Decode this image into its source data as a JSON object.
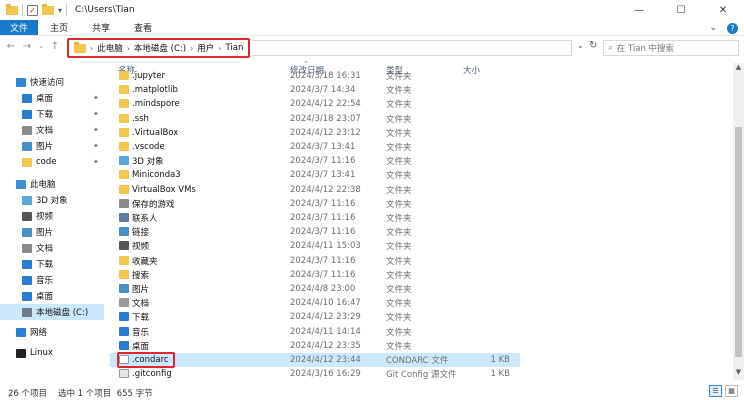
{
  "window": {
    "title": "C:\\Users\\Tian",
    "controls": [
      "—",
      "☐",
      "✕"
    ]
  },
  "ribbon": {
    "tabs": [
      "文件",
      "主页",
      "共享",
      "查看"
    ],
    "expand_icon": "chevron-down-icon",
    "help_label": "?"
  },
  "address": {
    "breadcrumbs": [
      "此电脑",
      "本地磁盘 (C:)",
      "用户",
      "Tian"
    ],
    "search_placeholder": "在 Tian 中搜索"
  },
  "columns": {
    "name": "名称",
    "date": "修改日期",
    "type": "类型",
    "size": "大小"
  },
  "sidebar": {
    "items": [
      {
        "label": "快速访问",
        "icon": "star-icon",
        "color": "#2f87d8"
      },
      {
        "label": "桌面",
        "icon": "desktop-icon",
        "color": "#2b7cd3",
        "pinned": true
      },
      {
        "label": "下载",
        "icon": "download-icon",
        "color": "#2b7cd3",
        "pinned": true
      },
      {
        "label": "文档",
        "icon": "document-icon",
        "color": "#8a8a8a",
        "pinned": true
      },
      {
        "label": "图片",
        "icon": "picture-icon",
        "color": "#4a90c8",
        "pinned": true
      },
      {
        "label": "code",
        "icon": "folder-icon",
        "color": "#f4c54f",
        "pinned": true
      },
      {
        "label": "此电脑",
        "icon": "computer-icon",
        "color": "#3b8fd6"
      },
      {
        "label": "3D 对象",
        "icon": "3d-objects-icon",
        "color": "#5aa7e0"
      },
      {
        "label": "视频",
        "icon": "video-icon",
        "color": "#555555"
      },
      {
        "label": "图片",
        "icon": "picture-icon",
        "color": "#4a90c8"
      },
      {
        "label": "文档",
        "icon": "document-icon",
        "color": "#8a8a8a"
      },
      {
        "label": "下载",
        "icon": "download-icon",
        "color": "#2b7cd3"
      },
      {
        "label": "音乐",
        "icon": "music-icon",
        "color": "#2b7cd3"
      },
      {
        "label": "桌面",
        "icon": "desktop-icon",
        "color": "#2b7cd3"
      },
      {
        "label": "本地磁盘 (C:)",
        "icon": "drive-icon",
        "color": "#6b7b8c",
        "selected": true
      },
      {
        "label": "网络",
        "icon": "network-icon",
        "color": "#2b7cd3"
      },
      {
        "label": "Linux",
        "icon": "linux-icon",
        "color": "#222222"
      }
    ]
  },
  "files": [
    {
      "name": ".jupyter",
      "date": "2024/3/18 16:31",
      "type": "文件夹",
      "size": "",
      "icon": "folder-icon"
    },
    {
      "name": ".matplotlib",
      "date": "2024/3/7 14:34",
      "type": "文件夹",
      "size": "",
      "icon": "folder-icon"
    },
    {
      "name": ".mindspore",
      "date": "2024/4/12 22:54",
      "type": "文件夹",
      "size": "",
      "icon": "folder-icon"
    },
    {
      "name": ".ssh",
      "date": "2024/3/18 23:07",
      "type": "文件夹",
      "size": "",
      "icon": "folder-icon"
    },
    {
      "name": ".VirtualBox",
      "date": "2024/4/12 23:12",
      "type": "文件夹",
      "size": "",
      "icon": "folder-icon"
    },
    {
      "name": ".vscode",
      "date": "2024/3/7 13:41",
      "type": "文件夹",
      "size": "",
      "icon": "folder-icon"
    },
    {
      "name": "3D 对象",
      "date": "2024/3/7 11:16",
      "type": "文件夹",
      "size": "",
      "icon": "3d-objects-icon"
    },
    {
      "name": "Miniconda3",
      "date": "2024/3/7 13:41",
      "type": "文件夹",
      "size": "",
      "icon": "folder-icon"
    },
    {
      "name": "VirtualBox VMs",
      "date": "2024/4/12 22:38",
      "type": "文件夹",
      "size": "",
      "icon": "folder-icon"
    },
    {
      "name": "保存的游戏",
      "date": "2024/3/7 11:16",
      "type": "文件夹",
      "size": "",
      "icon": "saved-games-icon"
    },
    {
      "name": "联系人",
      "date": "2024/3/7 11:16",
      "type": "文件夹",
      "size": "",
      "icon": "contacts-icon"
    },
    {
      "name": "链接",
      "date": "2024/3/7 11:16",
      "type": "文件夹",
      "size": "",
      "icon": "links-icon"
    },
    {
      "name": "视频",
      "date": "2024/4/11 15:03",
      "type": "文件夹",
      "size": "",
      "icon": "video-icon"
    },
    {
      "name": "收藏夹",
      "date": "2024/3/7 11:16",
      "type": "文件夹",
      "size": "",
      "icon": "favorites-icon"
    },
    {
      "name": "搜索",
      "date": "2024/3/7 11:16",
      "type": "文件夹",
      "size": "",
      "icon": "search-folder-icon"
    },
    {
      "name": "图片",
      "date": "2024/4/8 23:00",
      "type": "文件夹",
      "size": "",
      "icon": "picture-icon"
    },
    {
      "name": "文档",
      "date": "2024/4/10 16:47",
      "type": "文件夹",
      "size": "",
      "icon": "document-icon"
    },
    {
      "name": "下载",
      "date": "2024/4/12 23:29",
      "type": "文件夹",
      "size": "",
      "icon": "download-icon"
    },
    {
      "name": "音乐",
      "date": "2024/4/11 14:14",
      "type": "文件夹",
      "size": "",
      "icon": "music-icon"
    },
    {
      "name": "桌面",
      "date": "2024/4/12 23:35",
      "type": "文件夹",
      "size": "",
      "icon": "desktop-icon"
    },
    {
      "name": ".condarc",
      "date": "2024/4/12 23:44",
      "type": "CONDARC 文件",
      "size": "1 KB",
      "icon": "file-icon",
      "selected": true
    },
    {
      "name": ".gitconfig",
      "date": "2024/3/16 16:29",
      "type": "Git Config 源文件",
      "size": "1 KB",
      "icon": "gitconfig-icon"
    }
  ],
  "status": {
    "item_count": "26 个项目",
    "selection": "选中 1 个项目  655 字节"
  },
  "colors": {
    "accent": "#1979ca",
    "highlight_border": "#e0262f",
    "selection": "#cce8ff"
  }
}
